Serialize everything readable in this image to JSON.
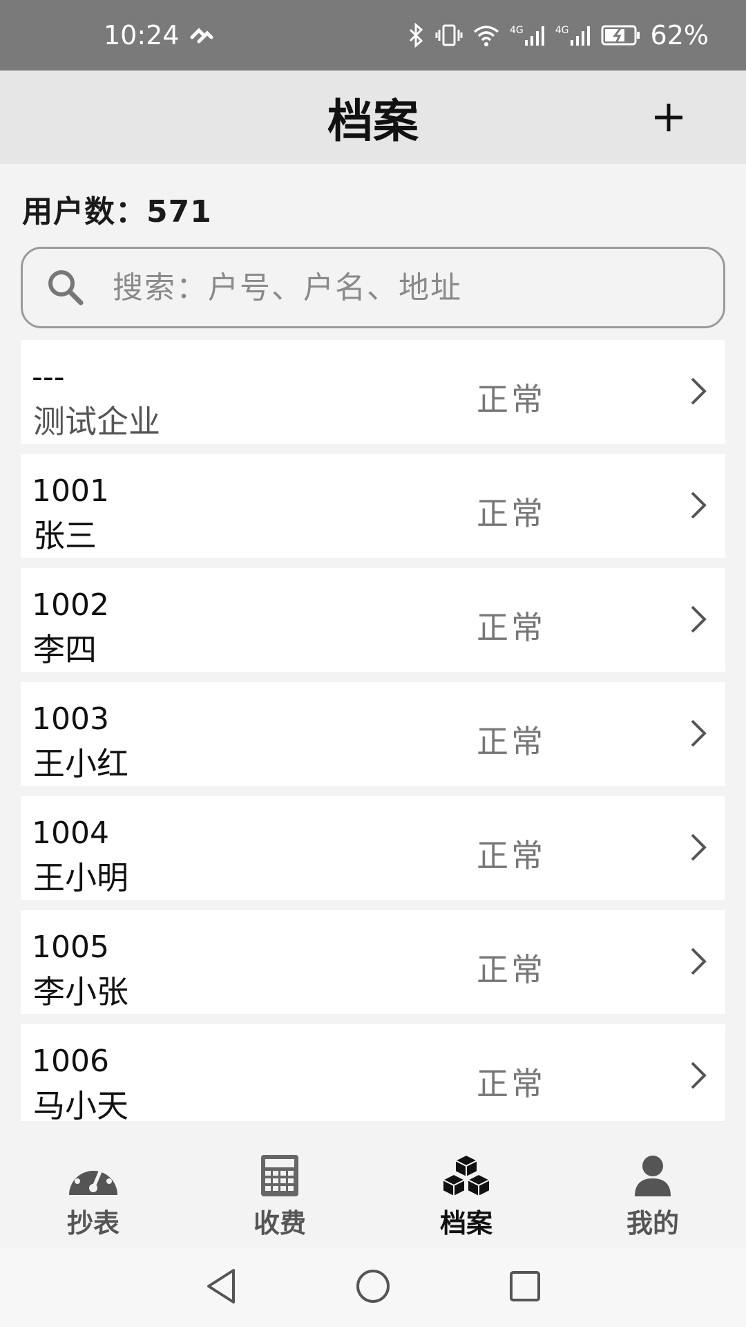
{
  "status_bar": {
    "time": "10:24",
    "battery": "62%",
    "network_1": "4G",
    "network_2": "4G"
  },
  "header": {
    "title": "档案",
    "add_icon": "plus-icon"
  },
  "user_count": "用户数：571",
  "search": {
    "placeholder": "搜索：户号、户名、地址",
    "value": ""
  },
  "records": [
    {
      "code": "---",
      "name": "测试企业",
      "status": "正常"
    },
    {
      "code": "1001",
      "name": "张三",
      "status": "正常"
    },
    {
      "code": "1002",
      "name": "李四",
      "status": "正常"
    },
    {
      "code": "1003",
      "name": "王小红",
      "status": "正常"
    },
    {
      "code": "1004",
      "name": "王小明",
      "status": "正常"
    },
    {
      "code": "1005",
      "name": "李小张",
      "status": "正常"
    },
    {
      "code": "1006",
      "name": "马小天",
      "status": "正常"
    }
  ],
  "bottom_nav": [
    {
      "label": "抄表",
      "icon": "speedometer-icon",
      "active": false
    },
    {
      "label": "收费",
      "icon": "calculator-icon",
      "active": false
    },
    {
      "label": "档案",
      "icon": "cubes-icon",
      "active": true
    },
    {
      "label": "我的",
      "icon": "person-icon",
      "active": false
    }
  ],
  "colors": {
    "status_bar": "#7a7a7a",
    "header_bg": "#e6e6e6",
    "page_bg": "#f3f3f3",
    "row_bg": "#ffffff",
    "status_text": "#777777"
  }
}
